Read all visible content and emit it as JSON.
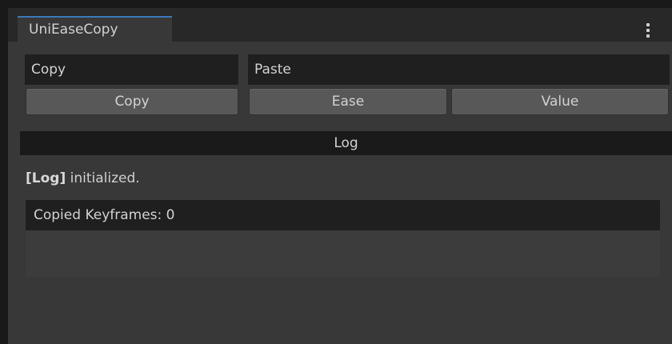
{
  "window": {
    "tab_title": "UniEaseCopy"
  },
  "fields": {
    "copy_label": "Copy",
    "paste_label": "Paste"
  },
  "buttons": {
    "copy": "Copy",
    "ease": "Ease",
    "value": "Value"
  },
  "log": {
    "header": "Log",
    "tag": "[Log]",
    "message": " initialized."
  },
  "status": {
    "copied_keyframes": "Copied Keyframes: 0"
  },
  "icons": {
    "menu": "kebab-menu-icon"
  },
  "colors": {
    "tab_accent": "#3a79bb",
    "panel_bg": "#383838",
    "button_bg": "#585858"
  }
}
